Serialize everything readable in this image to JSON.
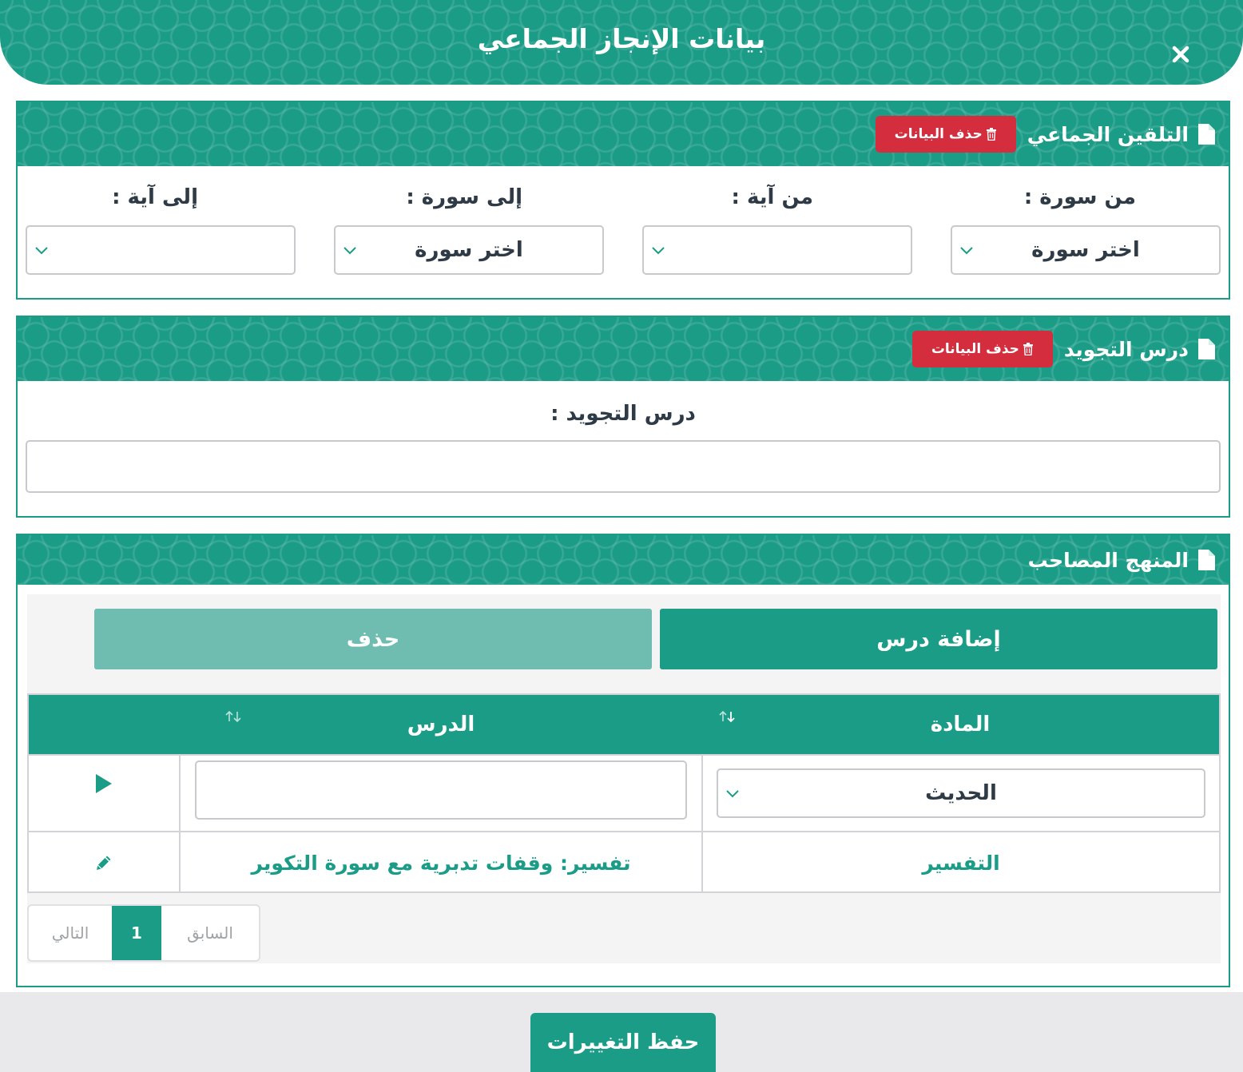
{
  "modal": {
    "title": "بيانات الإنجاز الجماعي",
    "close_icon": "close-icon"
  },
  "talqeen": {
    "title": "التلقين الجماعي",
    "delete_label": "حذف البيانات",
    "from_surah": {
      "label": "من سورة :",
      "value": "اختر سورة"
    },
    "from_ayah": {
      "label": "من آية :",
      "value": ""
    },
    "to_surah": {
      "label": "إلى سورة :",
      "value": "اختر سورة"
    },
    "to_ayah": {
      "label": "إلى آية :",
      "value": ""
    }
  },
  "tajweed": {
    "title": "درس التجويد",
    "delete_label": "حذف البيانات",
    "field_label": "درس التجويد :",
    "value": ""
  },
  "curriculum": {
    "title": "المنهج المصاحب",
    "add_label": "إضافة درس",
    "delete_label": "حذف",
    "columns": [
      "المادة",
      "الدرس"
    ],
    "rows": [
      {
        "subject": "الحديث",
        "lesson": ""
      },
      {
        "subject": "التفسير",
        "lesson": "تفسير: وقفات تدبرية مع سورة التكوير"
      }
    ],
    "pager": {
      "prev": "السابق",
      "page": "1",
      "next": "التالي"
    }
  },
  "footer": {
    "save_label": "حفظ التغييرات"
  },
  "colors": {
    "primary": "#1b9c86",
    "danger": "#d42d3e",
    "disabled": "#6fbdb0"
  }
}
